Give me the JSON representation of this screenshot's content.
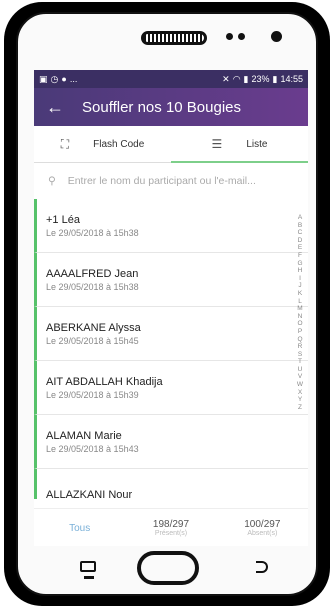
{
  "statusbar": {
    "left_icons": [
      "gallery-icon",
      "clock-icon",
      "app-icon"
    ],
    "ellipsis": "...",
    "battery": "23%",
    "time": "14:55"
  },
  "appbar": {
    "back": "←",
    "title": "Souffler nos 10 Bougies"
  },
  "tabs": [
    {
      "icon": "scan-icon",
      "label": "Flash Code"
    },
    {
      "icon": "list-icon",
      "label": "Liste"
    }
  ],
  "search": {
    "placeholder": "Entrer le nom du participant ou l'e-mail..."
  },
  "participants": [
    {
      "name": "+1 Léa",
      "date": "Le 29/05/2018 à 15h38"
    },
    {
      "name": "AAAALFRED Jean",
      "date": "Le 29/05/2018 à 15h38"
    },
    {
      "name": "ABERKANE Alyssa",
      "date": "Le 29/05/2018 à 15h45"
    },
    {
      "name": "AIT ABDALLAH Khadija",
      "date": "Le 29/05/2018 à 15h39"
    },
    {
      "name": "ALAMAN Marie",
      "date": "Le 29/05/2018 à 15h43"
    },
    {
      "name": "ALLAZKANI Nour",
      "date": ""
    }
  ],
  "alphabet": [
    "A",
    "B",
    "C",
    "D",
    "E",
    "F",
    "G",
    "H",
    "I",
    "J",
    "K",
    "L",
    "M",
    "N",
    "O",
    "P",
    "Q",
    "R",
    "S",
    "T",
    "U",
    "V",
    "W",
    "X",
    "Y",
    "Z"
  ],
  "bottom": {
    "tous": "Tous",
    "present_count": "198/297",
    "present_label": "Présent(s)",
    "absent_count": "100/297",
    "absent_label": "Absent(s)"
  },
  "colors": {
    "accent": "#56c26a",
    "appbar": "#4a3a78"
  }
}
